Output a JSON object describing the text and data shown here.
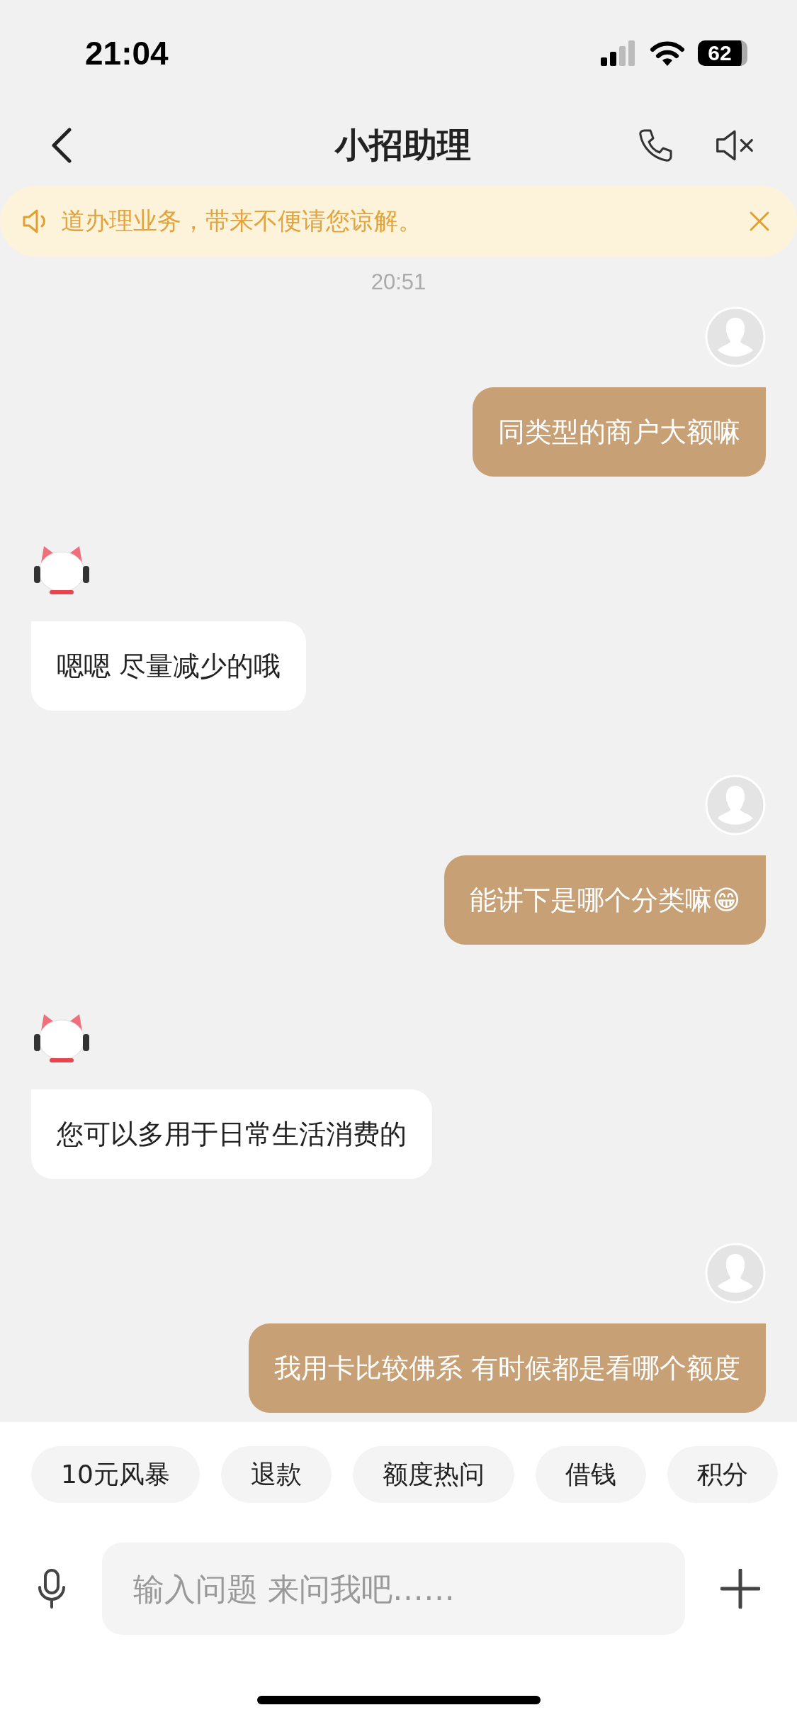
{
  "status_bar": {
    "time": "21:04",
    "battery": "62"
  },
  "header": {
    "title": "小招助理"
  },
  "notice": {
    "text": "道办理业务，带来不便请您谅解。"
  },
  "timestamp": "20:51",
  "messages": [
    {
      "kind": "user",
      "text": "同类型的商户大额嘛"
    },
    {
      "kind": "bot",
      "text": "嗯嗯 尽量减少的哦"
    },
    {
      "kind": "user",
      "text": "能讲下是哪个分类嘛😁"
    },
    {
      "kind": "bot",
      "text": "您可以多用于日常生活消费的"
    },
    {
      "kind": "user",
      "text": "我用卡比较佛系 有时候都是看哪个额度"
    }
  ],
  "quick_replies": [
    "10元风暴",
    "退款",
    "额度热问",
    "借钱",
    "积分"
  ],
  "input": {
    "placeholder": "输入问题 来问我吧……"
  }
}
